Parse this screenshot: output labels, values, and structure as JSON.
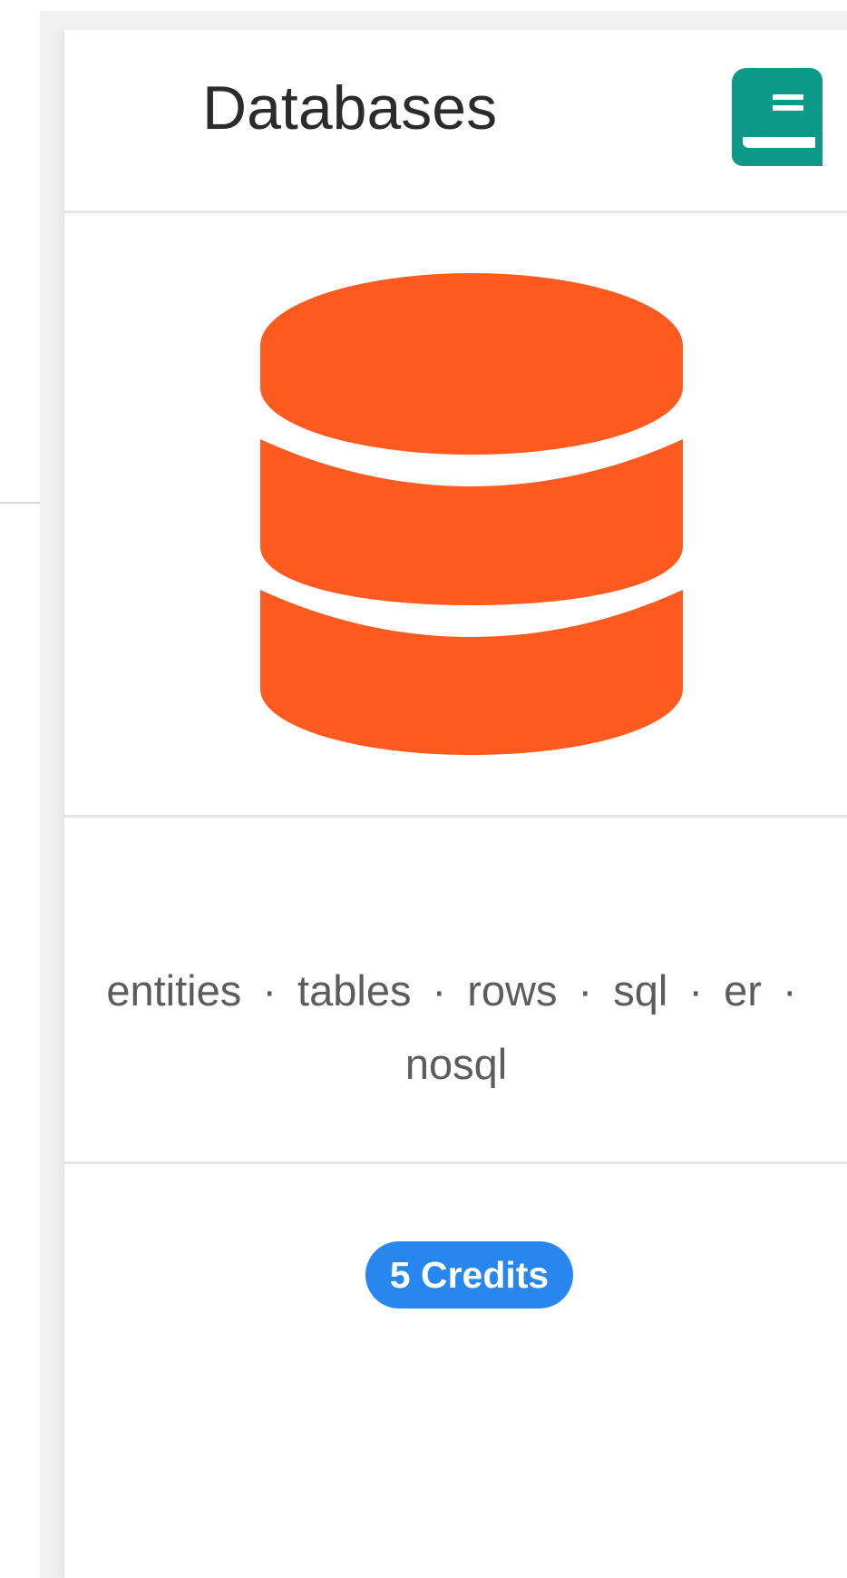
{
  "card": {
    "title": "Databases",
    "button_icon": "book-icon",
    "main_icon": "database-icon",
    "tags": [
      "entities",
      "tables",
      "rows",
      "sql",
      "er",
      "nosql"
    ],
    "separator": "·",
    "credits_badge": "5 Credits"
  },
  "colors": {
    "database_icon": "#ff5a1f",
    "book_icon": "#0d9988",
    "badge": "#2787ef",
    "divider": "#e5e5e5",
    "title": "#2b2b2b",
    "tags_text": "#5c5c5c"
  }
}
